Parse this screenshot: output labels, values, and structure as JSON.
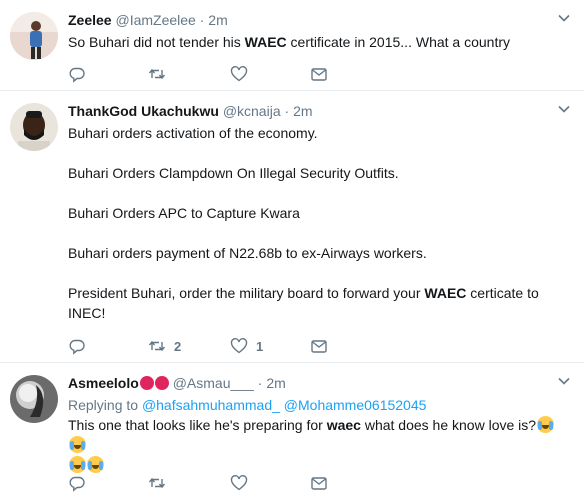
{
  "tweets": [
    {
      "name": "Zeelee",
      "handle": "@IamZeelee",
      "dot": "·",
      "time": "2m",
      "text_before": "So Buhari  did not tender his ",
      "text_bold": "WAEC",
      "text_after": " certificate in 2015... What a country",
      "retweets": "",
      "likes": ""
    },
    {
      "name": "ThankGod Ukachukwu",
      "handle": "@kcnaija",
      "dot": "·",
      "time": "2m",
      "lines": [
        "Buhari orders activation of the economy.",
        "Buhari Orders Clampdown On Illegal Security Outfits.",
        "Buhari Orders APC to Capture Kwara",
        "Buhari orders payment of N22.68b to ex-Airways workers."
      ],
      "last_before": "President Buhari, order the military board to forward your ",
      "last_bold": "WAEC",
      "last_after": " certicate to",
      "last_line2": "INEC!",
      "retweets": "2",
      "likes": "1"
    },
    {
      "name": "Asmeelolo",
      "handle": "@Asmau___",
      "dot": "·",
      "time": "2m",
      "replying_label": "Replying to",
      "mention1": "@hafsahmuhammad_",
      "mention2": "@Mohamme06152045",
      "text_before": "This one that looks like he's preparing for ",
      "text_bold": "waec",
      "text_after": " what does he know love is?",
      "retweets": "",
      "likes": ""
    }
  ],
  "colors": {
    "text": "#14171a",
    "muted": "#657786",
    "link": "#1da1f2",
    "divider": "#e6ecf0"
  },
  "icons": [
    "reply-icon",
    "retweet-icon",
    "like-icon",
    "direct-message-icon",
    "chevron-down-icon"
  ]
}
